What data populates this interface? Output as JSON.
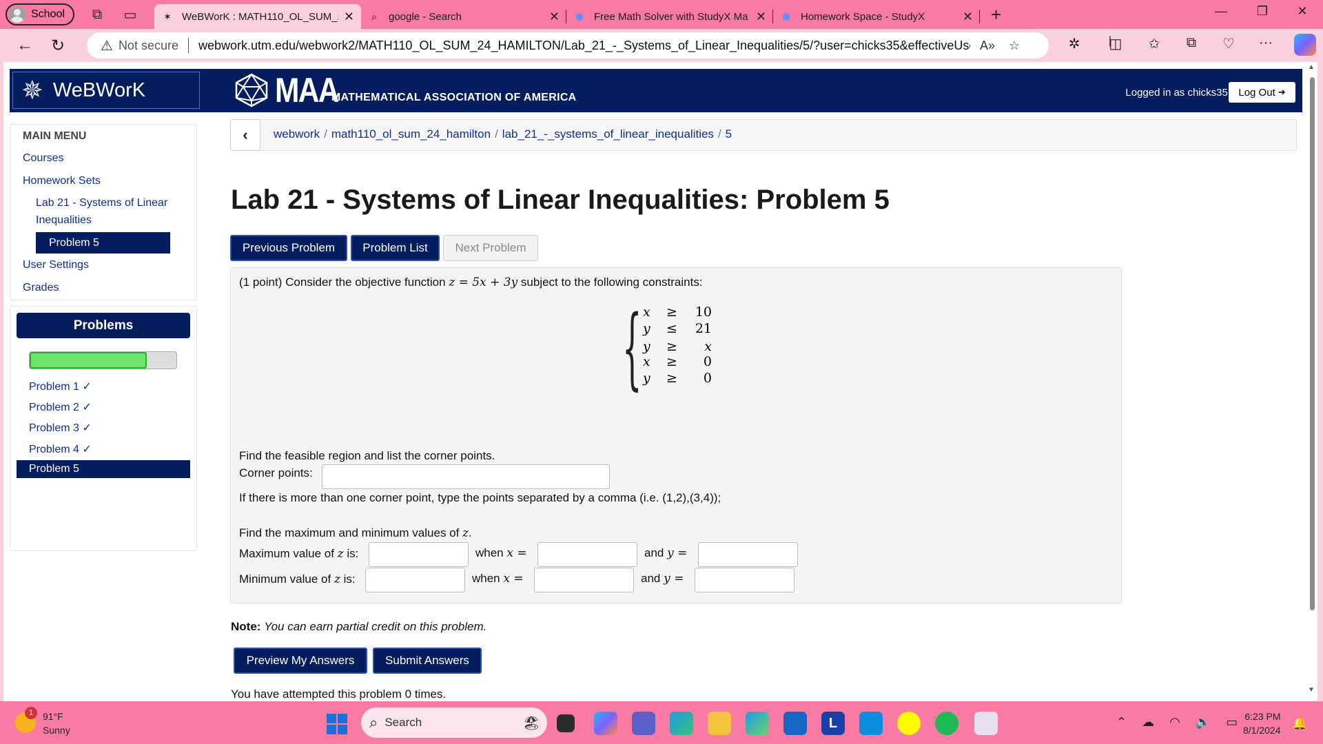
{
  "browser": {
    "profile": "School",
    "tabs": [
      {
        "title": "WeBWorK : MATH110_OL_SUM_2",
        "active": true
      },
      {
        "title": "google - Search",
        "active": false
      },
      {
        "title": "Free Math Solver with StudyX Ma",
        "active": false
      },
      {
        "title": "Homework Space - StudyX",
        "active": false
      }
    ],
    "not_secure": "Not secure",
    "url": "webwork.utm.edu/webwork2/MATH110_OL_SUM_24_HAMILTON/Lab_21_-_Systems_of_Linear_Inequalities/5/?user=chicks35&effectiveUser=chi..."
  },
  "header": {
    "brand": "WeBWorK",
    "maa_big": "MAA",
    "maa_small": "MATHEMATICAL ASSOCIATION OF AMERICA",
    "logged_in": "Logged in as chicks35.",
    "logout": "Log Out"
  },
  "sidebar": {
    "heading": "MAIN MENU",
    "courses": "Courses",
    "homework_sets": "Homework Sets",
    "set_line1": "Lab 21 - Systems of Linear",
    "set_line2": "Inequalities",
    "problem": "Problem 5",
    "user_settings": "User Settings",
    "grades": "Grades"
  },
  "problems_panel": {
    "heading": "Problems",
    "progress_fraction": 0.8,
    "items": [
      "Problem 1 ✓",
      "Problem 2 ✓",
      "Problem 3 ✓",
      "Problem 4 ✓",
      "Problem 5"
    ]
  },
  "breadcrumb": [
    "webwork",
    "math110_ol_sum_24_hamilton",
    "lab_21_-_systems_of_linear_inequalities",
    "5"
  ],
  "page_title": "Lab 21 - Systems of Linear Inequalities: Problem 5",
  "nav_buttons": {
    "previous": "Previous Problem",
    "list": "Problem List",
    "next": "Next Problem"
  },
  "problem": {
    "intro_pre": "(1 point) Consider the objective function ",
    "objective": "z = 5x + 3y",
    "intro_post": " subject to the following constraints:",
    "constraints": [
      {
        "var": "x",
        "rel": "≥",
        "val": "10"
      },
      {
        "var": "y",
        "rel": "≤",
        "val": "21"
      },
      {
        "var": "y",
        "rel": "≥",
        "val": "x"
      },
      {
        "var": "x",
        "rel": "≥",
        "val": "0"
      },
      {
        "var": "y",
        "rel": "≥",
        "val": "0"
      }
    ],
    "find_region": "Find the feasible region and list the corner points.",
    "corner_label": "Corner points:",
    "corner_hint": "If there is more than one corner point, type the points separated by a comma (i.e. (1,2),(3,4));",
    "find_maxmin_pre": "Find the maximum and minimum values of ",
    "find_maxmin_var": "z",
    "find_maxmin_post": ".",
    "max_label_pre": "Maximum value of ",
    "min_label_pre": "Minimum value of ",
    "zvar": "z",
    "is": " is:",
    "when": "when ",
    "xeq": "x =",
    "and": "and ",
    "yeq": "y ="
  },
  "note_bold": "Note:",
  "note_text": "You can earn partial credit on this problem.",
  "actions": {
    "preview": "Preview My Answers",
    "submit": "Submit Answers"
  },
  "attempts": "You have attempted this problem 0 times.",
  "taskbar": {
    "temp": "91°F",
    "condition": "Sunny",
    "badge": "1",
    "search": "Search",
    "time": "6:23 PM",
    "date": "8/1/2024"
  }
}
